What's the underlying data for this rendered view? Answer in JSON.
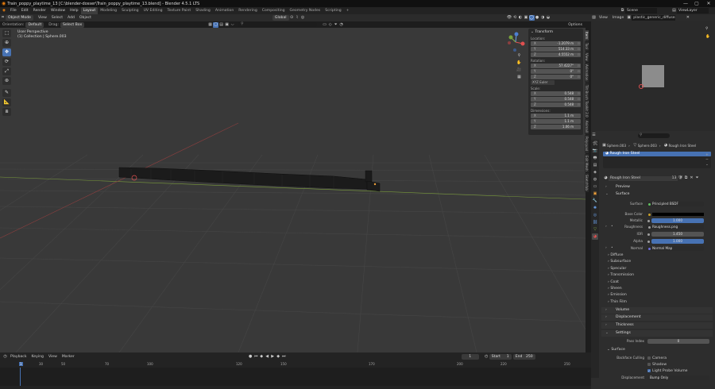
{
  "window": {
    "title": "Train_poppy_playtime_13 [C:\\blender-dosser\\Train_poppy_playtime_13.blend] - Blender 4.5.1 LTS",
    "min": "—",
    "max": "▢",
    "close": "✕"
  },
  "menu": {
    "items": [
      "File",
      "Edit",
      "Render",
      "Window",
      "Help"
    ],
    "workspaces": [
      "Layout",
      "Modeling",
      "Sculpting",
      "UV Editing",
      "Texture Paint",
      "Shading",
      "Animation",
      "Rendering",
      "Compositing",
      "Geometry Nodes",
      "Scripting",
      "+"
    ],
    "scene": "Scene",
    "view_layer": "ViewLayer"
  },
  "viewport_header": {
    "mode": "Object Mode",
    "menus": [
      "View",
      "Select",
      "Add",
      "Object"
    ],
    "orientation_label": "Orientation:",
    "orientation": "Default",
    "drag_label": "Drag:",
    "select_mode": "Select Box",
    "transform": "Global",
    "options": "Options",
    "search_placeholder": ""
  },
  "viewport": {
    "perspective": "User Perspective",
    "collection": "(1) Collection | Sphere.003"
  },
  "npanel": {
    "title": "Transform",
    "location_label": "Location:",
    "location": [
      {
        "k": "X",
        "v": "-1.2079 m"
      },
      {
        "k": "Y",
        "v": "514.33 m"
      },
      {
        "k": "Z",
        "v": "4.5552 m"
      }
    ],
    "rotation_label": "Rotation:",
    "rotation": [
      {
        "k": "X",
        "v": "57.4227°"
      },
      {
        "k": "Y",
        "v": "0°"
      },
      {
        "k": "Z",
        "v": "0°"
      }
    ],
    "euler": "XYZ Euler",
    "scale_label": "Scale:",
    "scale": [
      {
        "k": "X",
        "v": "0.548"
      },
      {
        "k": "Y",
        "v": "0.548"
      },
      {
        "k": "Z",
        "v": "0.548"
      }
    ],
    "dimensions_label": "Dimensions:",
    "dimensions": [
      {
        "k": "X",
        "v": "1.1 m"
      },
      {
        "k": "Y",
        "v": "1.1 m"
      },
      {
        "k": "Z",
        "v": "1.06 m"
      }
    ]
  },
  "side_tabs": [
    "Item",
    "Tool",
    "View",
    "Animation",
    "Tilt Brush Toolkit 2.0",
    "Animall",
    "Polyquad",
    "Edit Mesh",
    "Sketchfab"
  ],
  "timeline": {
    "menus": [
      "Playback",
      "Keying",
      "View",
      "Marker"
    ],
    "current_frame": "1",
    "start_label": "Start",
    "start": "1",
    "end_label": "End",
    "end": "250",
    "ticks": [
      "0",
      "30",
      "50",
      "70",
      "100",
      "120",
      "150",
      "170",
      "200",
      "220",
      "250"
    ]
  },
  "image_editor": {
    "menus": [
      "View",
      "Image"
    ],
    "image_name": "plastic_generic_diffuse.jpg"
  },
  "properties": {
    "search_placeholder": "",
    "breadcrumb": [
      "Sphere.003",
      "Sphere.003",
      "Rough Iron Steel"
    ],
    "material_slot": "Rough Iron Steel",
    "material_name": "Rough Iron Steel",
    "users": "13",
    "preview": "Preview",
    "surface_section": "Surface",
    "surface_label": "Surface",
    "surface_value": "Principled BSDF",
    "base_color_label": "Base Color",
    "metallic_label": "Metallic",
    "metallic": "1.000",
    "roughness_label": "Roughness",
    "roughness_value": "Roughness.png",
    "ior_label": "IOR",
    "ior": "1.450",
    "alpha_label": "Alpha",
    "alpha": "1.000",
    "normal_label": "Normal",
    "normal_value": "Normal Map",
    "subs": [
      "Diffuse",
      "Subsurface",
      "Specular",
      "Transmission",
      "Coat",
      "Sheen",
      "Emission",
      "Thin Film"
    ],
    "volume": "Volume",
    "displacement": "Displacement",
    "thickness": "Thickness",
    "settings": "Settings",
    "pass_index_label": "Pass Index",
    "pass_index": "0",
    "surface_sub": "Surface",
    "backface_label": "Backface Culling",
    "camera": "Camera",
    "shadow": "Shadow",
    "light_probe": "Light Probe Volume",
    "displacement_label": "Displacement",
    "displacement_value": "Bump Only"
  },
  "version": "4.5.1"
}
